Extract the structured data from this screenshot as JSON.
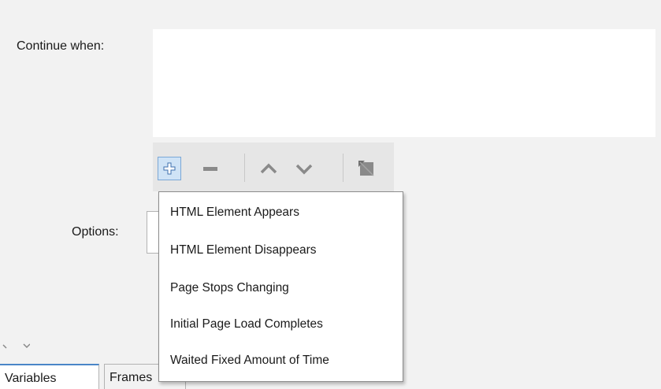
{
  "form": {
    "continue_label": "Continue when:",
    "options_label": "Options:"
  },
  "toolbar": {
    "add_icon": "plus-icon",
    "remove_icon": "minus-icon",
    "up_icon": "chevron-up-icon",
    "down_icon": "chevron-down-icon",
    "extra_icon": "edit-icon",
    "accent_color": "#7aa7d6"
  },
  "dropdown": {
    "items": [
      {
        "label": "HTML Element Appears"
      },
      {
        "label": "HTML Element Disappears"
      },
      {
        "label": "Page Stops Changing"
      },
      {
        "label": "Initial Page Load Completes"
      },
      {
        "label": "Waited Fixed Amount of Time"
      }
    ]
  },
  "bottom_tabs": [
    {
      "label": "Variables",
      "active": true
    },
    {
      "label": "Frames",
      "active": false
    }
  ]
}
